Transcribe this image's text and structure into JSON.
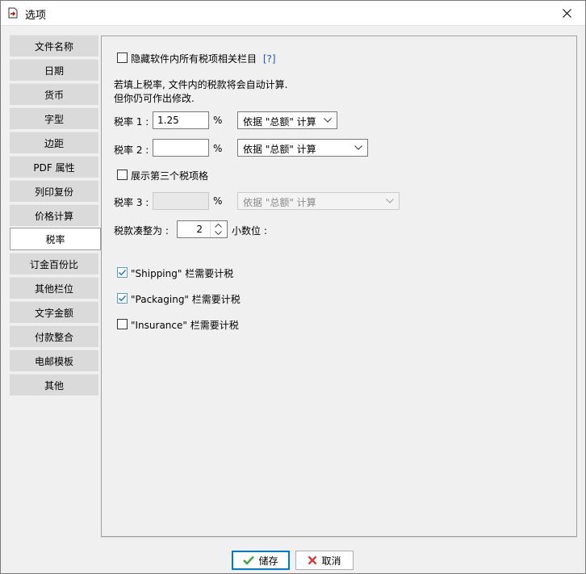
{
  "window": {
    "title": "选项",
    "icons": {
      "app": "export-icon",
      "close": "close-icon"
    }
  },
  "sidebar": {
    "items": [
      {
        "label": "文件名称"
      },
      {
        "label": "日期"
      },
      {
        "label": "货币"
      },
      {
        "label": "字型"
      },
      {
        "label": "边距"
      },
      {
        "label": "PDF 属性"
      },
      {
        "label": "列印复份"
      },
      {
        "label": "价格计算"
      },
      {
        "label": "税率",
        "active": true
      },
      {
        "label": "订金百份比"
      },
      {
        "label": "其他栏位"
      },
      {
        "label": "文字金额"
      },
      {
        "label": "付款整合"
      },
      {
        "label": "电邮模板"
      },
      {
        "label": "其他"
      }
    ]
  },
  "tax": {
    "hide_all": {
      "label": "隐藏软件内所有税项相关栏目",
      "help": "[?]",
      "checked": false
    },
    "info_line1": "若填上税率, 文件内的税款将会自动计算.",
    "info_line2": "但你仍可作出修改.",
    "rate1": {
      "label": "税率 1 :",
      "value": "1.25",
      "unit": "%",
      "basis": "依据 \"总额\" 计算"
    },
    "rate2": {
      "label": "税率 2 :",
      "value": "",
      "unit": "%",
      "basis": "依据 \"总额\" 计算"
    },
    "show_third": {
      "label": "展示第三个税项格",
      "checked": false
    },
    "rate3": {
      "label": "税率 3 :",
      "value": "",
      "unit": "%",
      "basis": "依据 \"总额\" 计算",
      "disabled": true
    },
    "rounding": {
      "label": "税款凑整为 :",
      "value": "2",
      "suffix": "小数位 :"
    },
    "shipping": {
      "label": "\"Shipping\" 栏需要计税",
      "checked": true
    },
    "packaging": {
      "label": "\"Packaging\" 栏需要计税",
      "checked": true
    },
    "insurance": {
      "label": "\"Insurance\" 栏需要计税",
      "checked": false
    }
  },
  "footer": {
    "save": {
      "label": "储存",
      "icon": "check-icon",
      "color": "#3aa83a"
    },
    "cancel": {
      "label": "取消",
      "icon": "x-icon",
      "color": "#d93a3a"
    }
  },
  "colors": {
    "checkbox_checked": "#1e6fd9",
    "help_link": "#1f57c7"
  }
}
